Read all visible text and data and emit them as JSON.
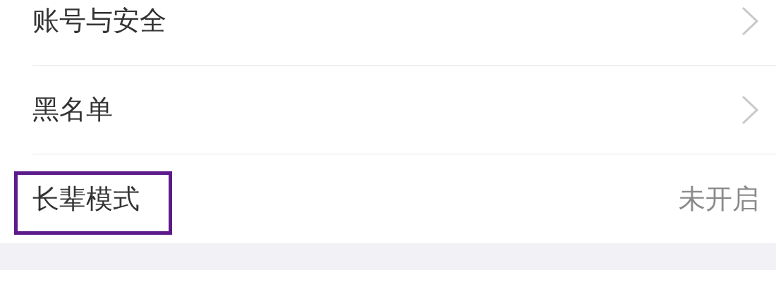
{
  "settings": [
    {
      "kind": "link",
      "label": "账号与安全",
      "highlighted": false
    },
    {
      "kind": "link",
      "label": "黑名单",
      "highlighted": false
    },
    {
      "kind": "value",
      "label": "长辈模式",
      "value": "未开启",
      "highlighted": true
    }
  ]
}
